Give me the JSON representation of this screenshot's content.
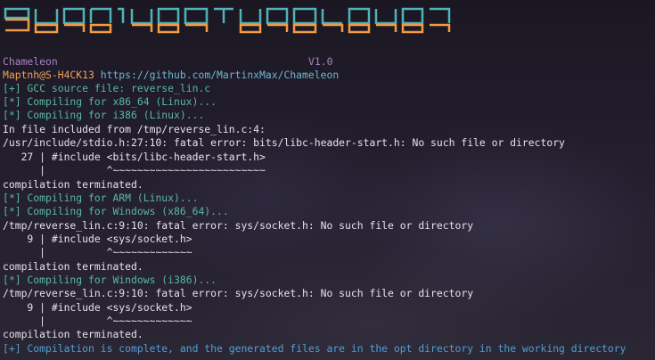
{
  "header": {
    "app_name": "Chameleon",
    "version": "V1.0",
    "author": "Maptnh@S-H4CK13",
    "url": "https://github.com/MartinxMax/Chameleon"
  },
  "colors": {
    "banner_teal": "#4fb3b8",
    "banner_orange": "#f29a44",
    "info_green": "#58b9a0",
    "final_blue": "#4f9fd6"
  },
  "log": [
    "[+] GCC source file: reverse_lin.c",
    "[*] Compiling for x86_64 (Linux)...",
    "[*] Compiling for i386 (Linux)...",
    "In file included from /tmp/reverse_lin.c:4:",
    "/usr/include/stdio.h:27:10: fatal error: bits/libc-header-start.h: No such file or directory",
    "   27 | #include <bits/libc-header-start.h>",
    "      |          ^~~~~~~~~~~~~~~~~~~~~~~~~~",
    "compilation terminated.",
    "[*] Compiling for ARM (Linux)...",
    "[*] Compiling for Windows (x86_64)...",
    "/tmp/reverse_lin.c:9:10: fatal error: sys/socket.h: No such file or directory",
    "    9 | #include <sys/socket.h>",
    "      |          ^~~~~~~~~~~~~~",
    "compilation terminated.",
    "[*] Compiling for Windows (i386)...",
    "/tmp/reverse_lin.c:9:10: fatal error: sys/socket.h: No such file or directory",
    "    9 | #include <sys/socket.h>",
    "      |          ^~~~~~~~~~~~~~",
    "compilation terminated.",
    "[+] Compilation is complete, and the generated files are in the opt directory in the working directory"
  ]
}
